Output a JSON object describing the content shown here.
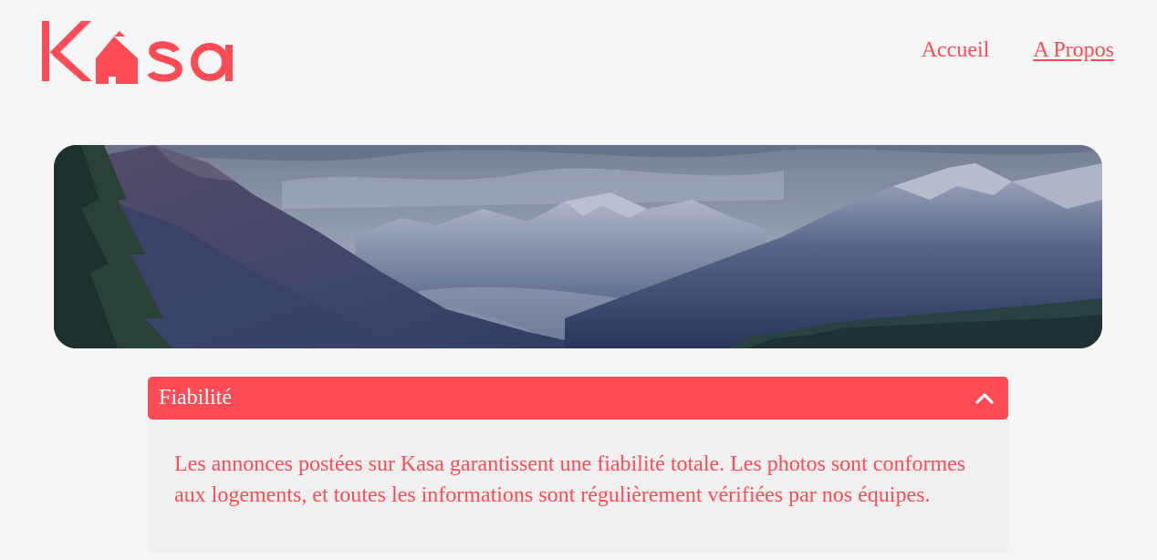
{
  "brand": {
    "logo_text": "Kasa",
    "accent_color": "#ff4b55"
  },
  "nav": {
    "items": [
      {
        "label": "Accueil",
        "active": false
      },
      {
        "label": "A Propos",
        "active": true
      }
    ]
  },
  "banner": {
    "image_subject": "mountain valley landscape"
  },
  "collapse": {
    "title": "Fiabilité",
    "expanded": true,
    "icon": "chevron-up-icon",
    "content": "Les annonces postées sur Kasa garantissent une fiabilité totale. Les photos sont conformes aux logements, et toutes les informations sont régulièrement vérifiées par nos équipes."
  }
}
